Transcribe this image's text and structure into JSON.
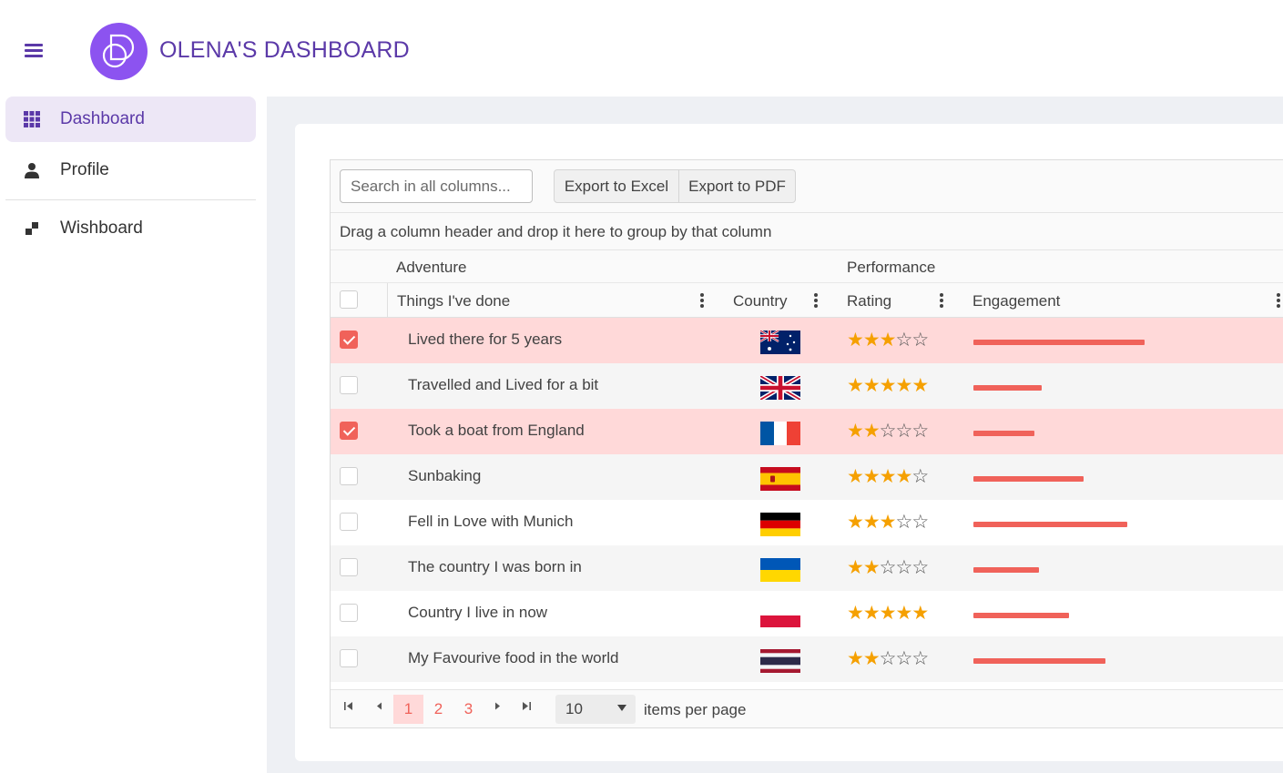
{
  "header": {
    "title": "OLENA'S DASHBOARD"
  },
  "sidebar": {
    "items": [
      {
        "label": "Dashboard",
        "icon": "grid-icon",
        "active": true
      },
      {
        "label": "Profile",
        "icon": "person-icon",
        "active": false
      },
      {
        "label": "Wishboard",
        "icon": "blocks-icon",
        "active": false
      }
    ]
  },
  "grid": {
    "search_placeholder": "Search in all columns...",
    "export_excel_label": "Export to Excel",
    "export_pdf_label": "Export to PDF",
    "group_panel_text": "Drag a column header and drop it here to group by that column",
    "group_headers": {
      "adventure": "Adventure",
      "performance": "Performance"
    },
    "columns": {
      "things": "Things I've done",
      "country": "Country",
      "rating": "Rating",
      "engagement": "Engagement"
    },
    "rows": [
      {
        "thing": "Lived there for 5 years",
        "country": "australia",
        "rating": 3,
        "engagement": 0.7,
        "selected": true
      },
      {
        "thing": "Travelled and Lived for a bit",
        "country": "uk",
        "rating": 5,
        "engagement": 0.28,
        "selected": false
      },
      {
        "thing": "Took a boat from England",
        "country": "france",
        "rating": 2,
        "engagement": 0.25,
        "selected": true
      },
      {
        "thing": "Sunbaking",
        "country": "spain",
        "rating": 4,
        "engagement": 0.45,
        "selected": false
      },
      {
        "thing": "Fell in Love with Munich",
        "country": "germany",
        "rating": 3,
        "engagement": 0.63,
        "selected": false
      },
      {
        "thing": "The country I was born in",
        "country": "ukraine",
        "rating": 2,
        "engagement": 0.27,
        "selected": false
      },
      {
        "thing": "Country I live in now",
        "country": "poland",
        "rating": 5,
        "engagement": 0.39,
        "selected": false
      },
      {
        "thing": "My Favourive food in the world",
        "country": "thailand",
        "rating": 2,
        "engagement": 0.54,
        "selected": false
      }
    ],
    "pager": {
      "pages": [
        "1",
        "2",
        "3"
      ],
      "current_page": "1",
      "page_size": "10",
      "items_per_page_label": "items per page"
    }
  },
  "colors": {
    "accent": "#5b39a8",
    "logo": "#8c53f0",
    "selection": "#ffd9d9",
    "bar": "#f0625a",
    "star": "#f5a000"
  }
}
